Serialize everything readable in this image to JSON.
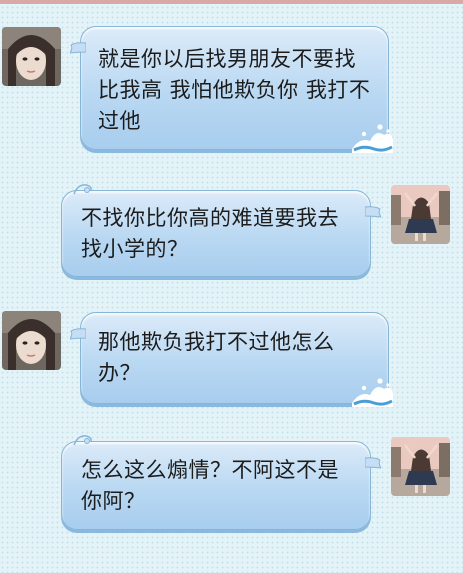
{
  "conversation": {
    "messages": [
      {
        "sender": "them",
        "avatar": "girl-face-avatar",
        "text": "就是你以后找男朋友不要找比我高 我怕他欺负你 我打不过他"
      },
      {
        "sender": "me",
        "avatar": "girl-back-avatar",
        "text": "不找你比你高的难道要我去找小学的？"
      },
      {
        "sender": "them",
        "avatar": "girl-face-avatar",
        "text": "那他欺负我打不过他怎么办？"
      },
      {
        "sender": "me",
        "avatar": "girl-back-avatar",
        "text": "怎么这么煽情？不阿这不是你阿？"
      }
    ]
  },
  "colors": {
    "background": "#e4f3f7",
    "bubble_top": "#dcebf9",
    "bubble_bottom": "#a8cdee",
    "bubble_border": "#86b5d6",
    "top_strip": "#d9a9a7"
  }
}
